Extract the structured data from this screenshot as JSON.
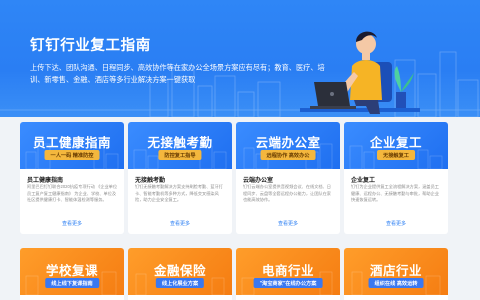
{
  "hero": {
    "title": "钉钉行业复工指南",
    "description": "上传下达、团队沟通、日程同步、高效协作等在家办公全场景方案应有尽有；教育、医疗、培训、新零售、金融、酒店等多行业解决方案一键获取"
  },
  "cards": [
    {
      "title": "员工健康指南",
      "tag": "一人一码 精准防控",
      "name": "员工健康指南",
      "desc": "阿里巴巴钉钉联合2020抗疫专项行动 《企业单位员工复产复工健康指南》 为企业、学校、单位及社区提供健康打卡、智能体温检测等服务。",
      "more": "查看更多",
      "color": "#2a7ef3"
    },
    {
      "title": "无接触考勤",
      "tag": "防控复工指导",
      "name": "无接触考勤",
      "desc": "钉钉无接触考勤解决方案支持刷脸考勤、蓝牙打卡、智能考勤机等多种方式，降低交叉感染风险，助力企业安全复工。",
      "more": "查看更多",
      "color": "#2a7ef3"
    },
    {
      "title": "云端办公室",
      "tag": "远程协作 高效办公",
      "name": "云端办公室",
      "desc": "钉钉云端办公室提供音视频会议、在线文档、日程同步、云盘等全套远程办公能力，让团队在家也能高效协作。",
      "more": "查看更多",
      "color": "#2a7ef3"
    },
    {
      "title": "企业复工",
      "tag": "无接触复工",
      "name": "企业复工",
      "desc": "钉钉为企业提供复工全流程解决方案，涵盖员工健康、远程办公、无接触考勤与审批，帮助企业快速恢复运转。",
      "more": "查看更多",
      "color": "#2a7ef3"
    },
    {
      "title": "学校复课",
      "tag": "线上线下复课指南",
      "color": "#f58a1f"
    },
    {
      "title": "金融保险",
      "tag": "线上化展业方案",
      "color": "#f58a1f"
    },
    {
      "title": "电商行业",
      "tag": "\"淘宝商家\"在线办公方案",
      "color": "#f58a1f"
    },
    {
      "title": "酒店行业",
      "tag": "组织在线 高效运转",
      "color": "#f58a1f"
    }
  ]
}
